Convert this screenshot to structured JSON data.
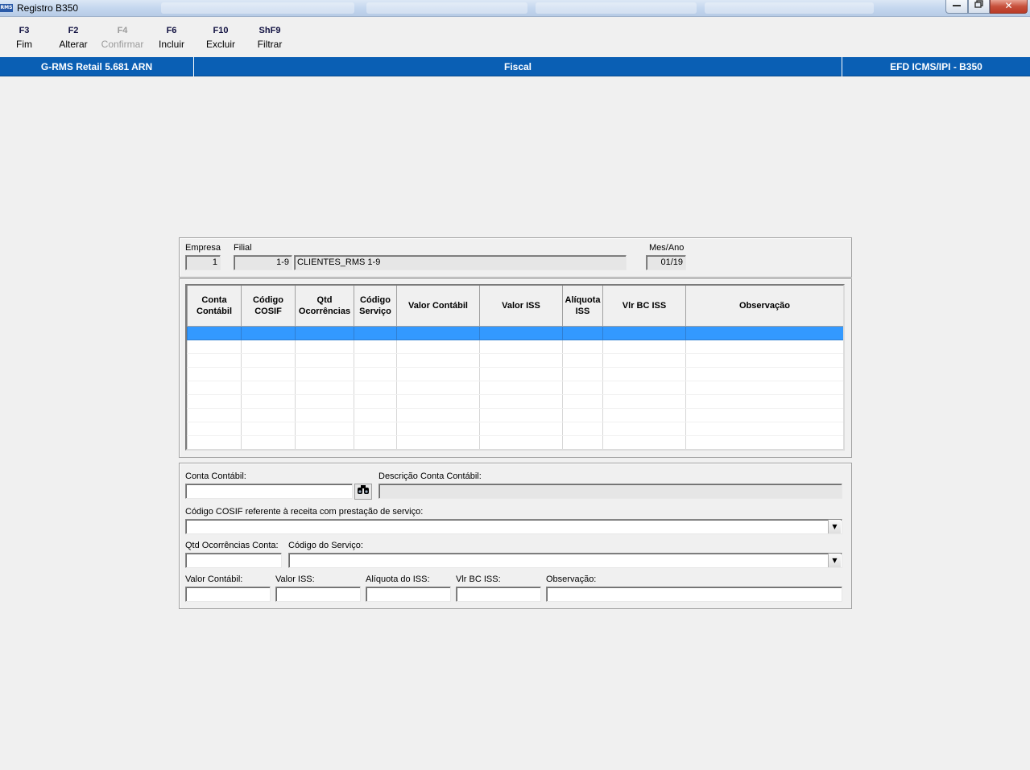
{
  "window": {
    "title": "Registro B350",
    "app_icon": "RMS",
    "close_glyph": "✕"
  },
  "toolbar": {
    "items": [
      {
        "key": "F3",
        "label": "Fim",
        "enabled": true
      },
      {
        "key": "F2",
        "label": "Alterar",
        "enabled": true
      },
      {
        "key": "F4",
        "label": "Confirmar",
        "enabled": false
      },
      {
        "key": "F6",
        "label": "Incluir",
        "enabled": true
      },
      {
        "key": "F10",
        "label": "Excluir",
        "enabled": true
      },
      {
        "key": "ShF9",
        "label": "Filtrar",
        "enabled": true
      }
    ]
  },
  "header": {
    "left": "G-RMS Retail 5.681 ARN",
    "center": "Fiscal",
    "right": "EFD ICMS/IPI - B350",
    "color": "#0a5fb4"
  },
  "filter": {
    "empresa_label": "Empresa",
    "empresa_value": "1",
    "filial_label": "Filial",
    "filial_code": "1-9",
    "filial_name": "CLIENTES_RMS 1-9",
    "mesano_label": "Mes/Ano",
    "mesano_value": "01/19"
  },
  "grid": {
    "columns": [
      [
        "Conta",
        "Contábil"
      ],
      [
        "Código",
        "COSIF"
      ],
      [
        "Qtd",
        "Ocorrências"
      ],
      [
        "Código",
        "Serviço"
      ],
      [
        "Valor Contábil"
      ],
      [
        "Valor ISS"
      ],
      [
        "Alíquota",
        "ISS"
      ],
      [
        "Vlr BC ISS"
      ],
      [
        "Observação"
      ]
    ],
    "selected_row_color": "#3399ff"
  },
  "form": {
    "conta_label": "Conta Contábil:",
    "conta_value": "",
    "search_icon": "binoculars-icon",
    "descricao_label": "Descrição Conta Contábil:",
    "descricao_value": "",
    "cosif_label": "Código COSIF referente à receita com prestação de serviço:",
    "cosif_value": "",
    "qtd_label": "Qtd Ocorrências Conta:",
    "qtd_value": "",
    "servico_label": "Código do Serviço:",
    "servico_value": "",
    "valor_contabil_label": "Valor Contábil:",
    "valor_iss_label": "Valor ISS:",
    "aliquota_label": "Alíquota do ISS:",
    "vlr_bc_label": "Vlr BC ISS:",
    "observacao_label": "Observação:"
  }
}
